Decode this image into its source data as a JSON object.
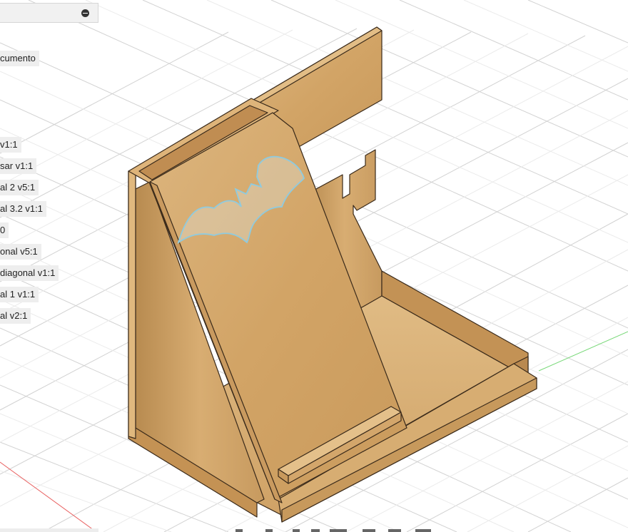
{
  "browser": {
    "toggle_icon": "minus-circle-icon",
    "document_label": "cumento",
    "components": [
      "v1:1",
      "sar v1:1",
      "al 2 v5:1",
      "al 3.2 v1:1",
      "0",
      "onal v5:1",
      "diagonal v1:1",
      "al 1 v1:1",
      "al v2:1"
    ]
  },
  "model": {
    "name": "phone stand",
    "decal": "bat-emblem",
    "wood_color": "#d4a56a",
    "decal_color": "#8ecbe0"
  },
  "toolbar": {
    "icons": [
      "orbit-icon",
      "pan-icon",
      "zoom-icon",
      "fit-icon",
      "display-icon",
      "grid-icon",
      "viewports-icon"
    ]
  }
}
